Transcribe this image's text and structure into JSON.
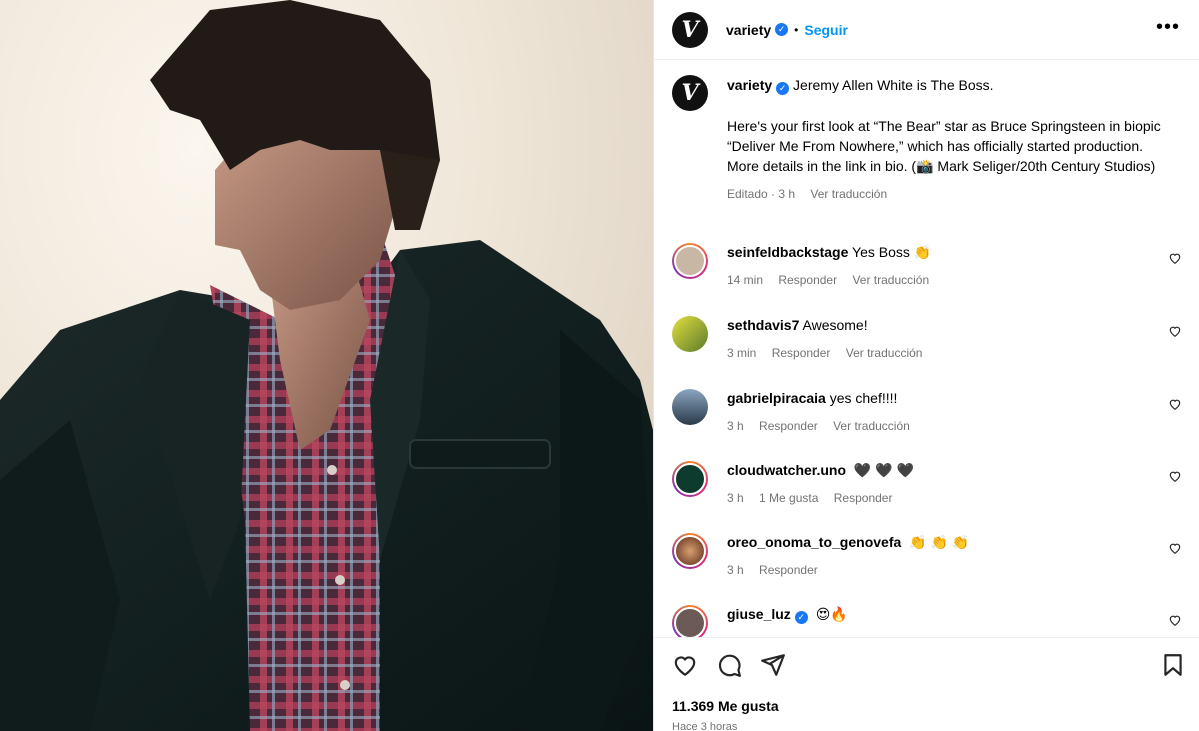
{
  "post": {
    "username": "variety",
    "follow_label": "Seguir",
    "more_icon": "more-horizontal-icon",
    "avatar_letter": "V"
  },
  "caption": {
    "username": "variety",
    "line1": "Jeremy Allen White is The Boss.",
    "line2": "Here's your first look at “The Bear” star as Bruce Springsteen in biopic “Deliver Me From Nowhere,” which has officially started production. More details in the link in bio. (📸 Mark Seliger/20th Century Studios)",
    "edited": "Editado",
    "time": "3 h",
    "translate": "Ver traducción"
  },
  "comments": [
    {
      "username": "seinfeldbackstage",
      "text": "Yes Boss",
      "emoji": "👏",
      "time": "14 min",
      "reply": "Responder",
      "translate": "Ver traducción",
      "avatar_color": "#c9b7a5"
    },
    {
      "username": "sethdavis7",
      "text": "Awesome!",
      "emoji": "",
      "time": "3 min",
      "reply": "Responder",
      "translate": "Ver traducción",
      "avatar_color": "#e4e040"
    },
    {
      "username": "gabrielpiracaia",
      "text": "yes chef!!!!",
      "emoji": "",
      "time": "3 h",
      "reply": "Responder",
      "translate": "Ver traducción",
      "avatar_color": "#3b5a7a"
    },
    {
      "username": "cloudwatcher.uno",
      "text": "",
      "emoji": "🖤 🖤 🖤",
      "time": "3 h",
      "likes": "1 Me gusta",
      "reply": "Responder",
      "avatar_color": "#0d3b2e"
    },
    {
      "username": "oreo_onoma_to_genovefa",
      "text": "",
      "emoji": "👏 👏 👏",
      "time": "3 h",
      "reply": "Responder",
      "avatar_color": "#7a3a2a"
    },
    {
      "username": "giuse_luz",
      "text": "",
      "emoji": "😍🔥",
      "avatar_color": "#6b5a55"
    }
  ],
  "actions": {
    "like_icon": "heart-icon",
    "comment_icon": "comment-icon",
    "share_icon": "send-icon",
    "save_icon": "bookmark-icon",
    "likes": "11.369 Me gusta",
    "ago": "Hace 3 horas"
  },
  "colors": {
    "accent": "#0095f6",
    "verified": "#1877f2",
    "muted": "#737373"
  }
}
